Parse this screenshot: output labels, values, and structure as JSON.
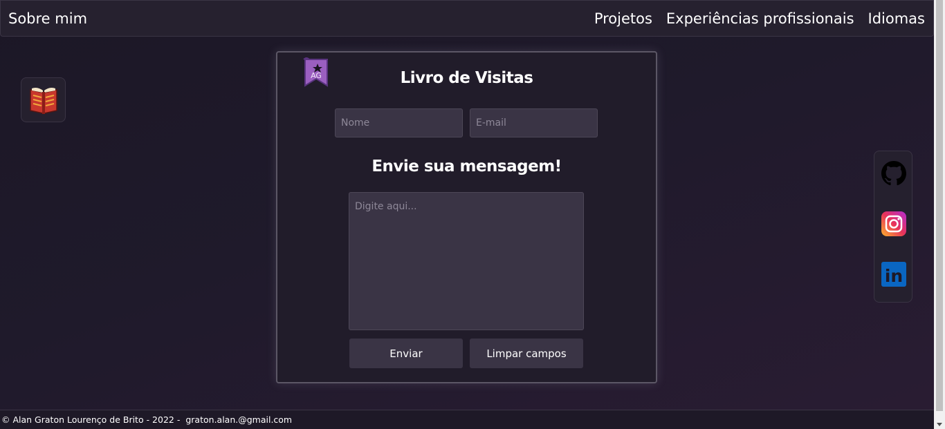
{
  "nav": {
    "brand": "Sobre mim",
    "links": [
      "Projetos",
      "Experiências profissionais",
      "Idiomas"
    ]
  },
  "guestbook": {
    "logo_text": "AG",
    "title": "Livro de Visitas",
    "name_placeholder": "Nome",
    "email_placeholder": "E-mail",
    "message_heading": "Envie sua mensagem!",
    "message_placeholder": "Digite aqui...",
    "send_label": "Enviar",
    "clear_label": "Limpar campos"
  },
  "social": {
    "icons": [
      "github-icon",
      "instagram-icon",
      "linkedin-icon"
    ],
    "linkedin_text": "in"
  },
  "footer": {
    "copyright": "© Alan Graton Lourenço de Brito - 2022 -",
    "email": "graton.alan.@gmail.com"
  },
  "colors": {
    "background": "#1f1a2b",
    "card": "#211c2a",
    "input": "#3a3445",
    "accent_logo": "#9b5fc0"
  }
}
